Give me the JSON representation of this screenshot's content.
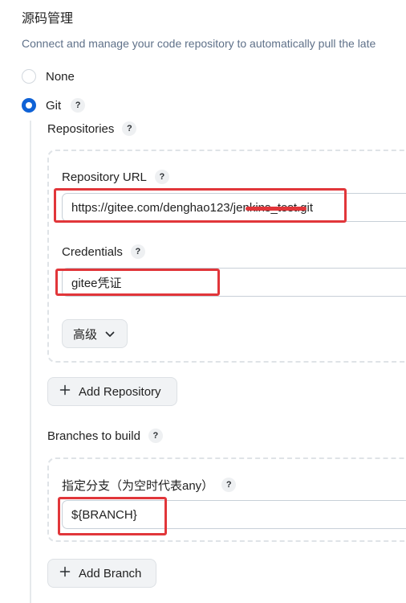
{
  "section": {
    "title": "源码管理",
    "description": "Connect and manage your code repository to automatically pull the late"
  },
  "scm_options": [
    {
      "label": "None",
      "selected": false
    },
    {
      "label": "Git",
      "selected": true
    }
  ],
  "help_glyph": "?",
  "repositories": {
    "label": "Repositories",
    "url_label": "Repository URL",
    "url_value": "https://gitee.com/denghao123/jenkins_test.git",
    "credentials_label": "Credentials",
    "credentials_value": "gitee凭证",
    "advanced_label": "高级",
    "add_label": "Add Repository"
  },
  "branches": {
    "label": "Branches to build",
    "specifier_label": "指定分支（为空时代表any）",
    "specifier_value": "${BRANCH}",
    "add_label": "Add Branch"
  },
  "colors": {
    "accent": "#0f62d6",
    "annotation_red": "#e1363a"
  }
}
